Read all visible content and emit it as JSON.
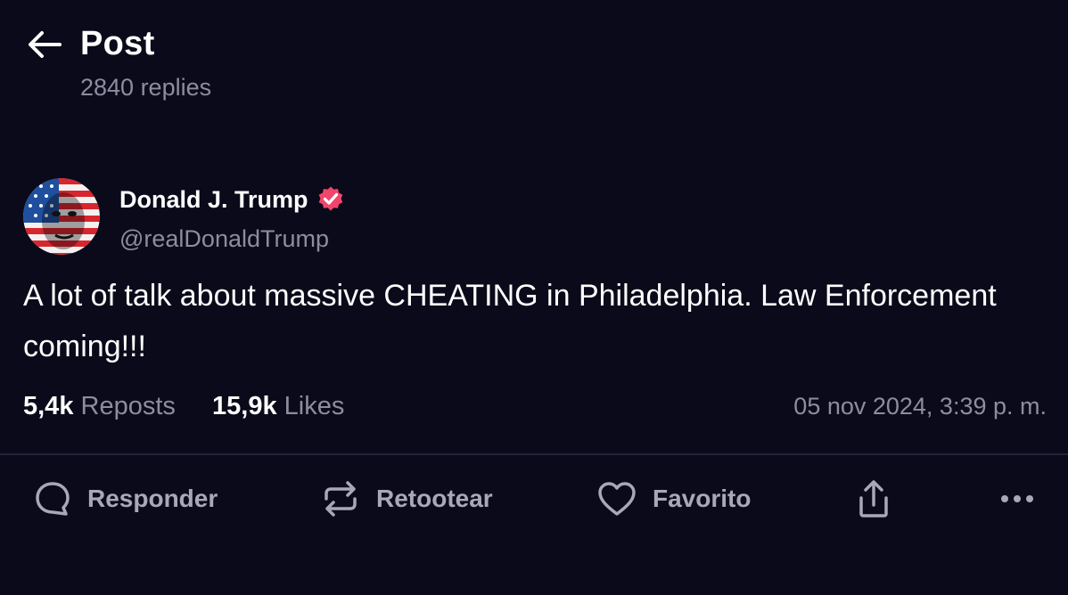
{
  "header": {
    "title": "Post",
    "reply_count": "2840 replies"
  },
  "post": {
    "author": {
      "display_name": "Donald J. Trump",
      "handle": "@realDonaldTrump",
      "verified": true
    },
    "text": "A lot of talk about massive CHEATING in Philadelphia. Law Enforcement coming!!!",
    "reposts_count": "5,4k",
    "reposts_label": "Reposts",
    "likes_count": "15,9k",
    "likes_label": "Likes",
    "timestamp": "05 nov 2024, 3:39 p. m."
  },
  "actions": {
    "reply_label": "Responder",
    "retoot_label": "Retootear",
    "favorite_label": "Favorito",
    "share_icon": "share-icon",
    "more_icon": "more-icon"
  },
  "colors": {
    "background": "#0b0a1a",
    "muted_text": "#8e8c9e",
    "verified_badge": "#f2456c",
    "divider": "#23223a"
  }
}
